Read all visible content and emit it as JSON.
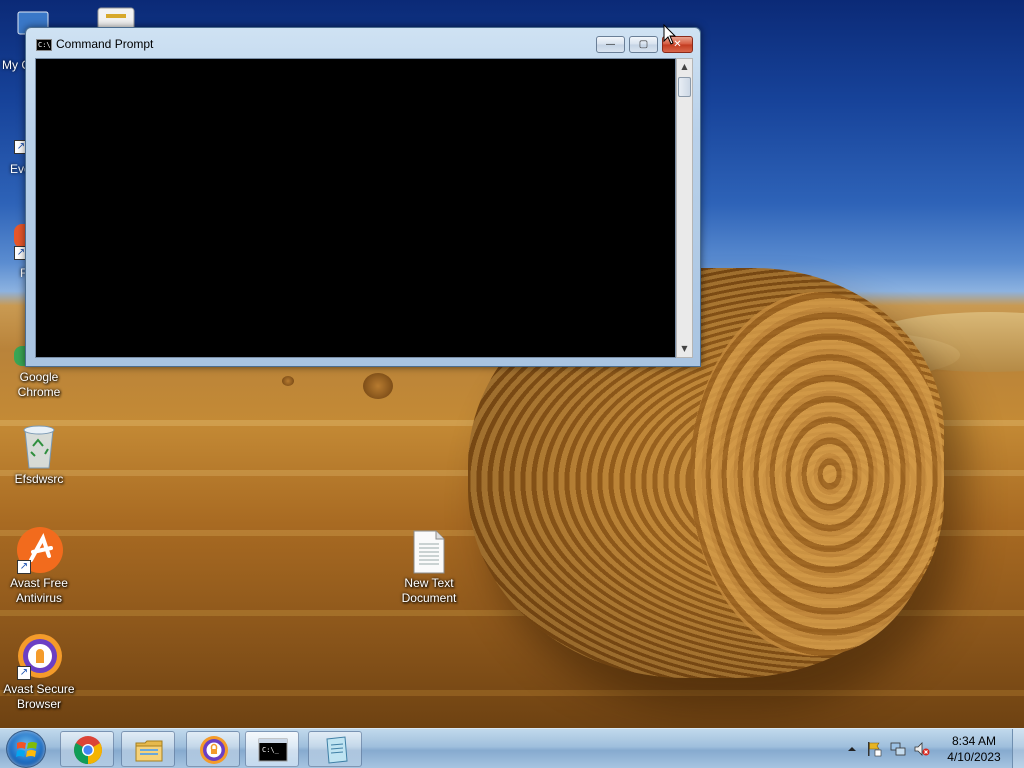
{
  "desktop": {
    "icons": [
      {
        "label": "Google Chrome"
      },
      {
        "label": "Efsdwsrc"
      },
      {
        "label": "Avast Free Antivirus"
      },
      {
        "label": "Avast Secure Browser"
      },
      {
        "label": "New Text Document"
      }
    ],
    "partial_labels": [
      "My C",
      "Eve",
      "F"
    ]
  },
  "window": {
    "title": "Command Prompt",
    "app_icon_text": "C:\\",
    "buttons": {
      "minimize": "—",
      "maximize": "▢",
      "close": "✕"
    }
  },
  "taskbar": {
    "pinned": [
      "chrome-icon",
      "file-explorer-icon",
      "avast-secure-browser-icon",
      "command-prompt-icon",
      "notepad-icon"
    ],
    "active": "Command Prompt",
    "tray": {
      "time": "8:34 AM",
      "date": "4/10/2023",
      "icons": [
        "show-hidden-icons",
        "action-center-flag-icon",
        "network-icon",
        "volume-muted-icon"
      ]
    }
  }
}
